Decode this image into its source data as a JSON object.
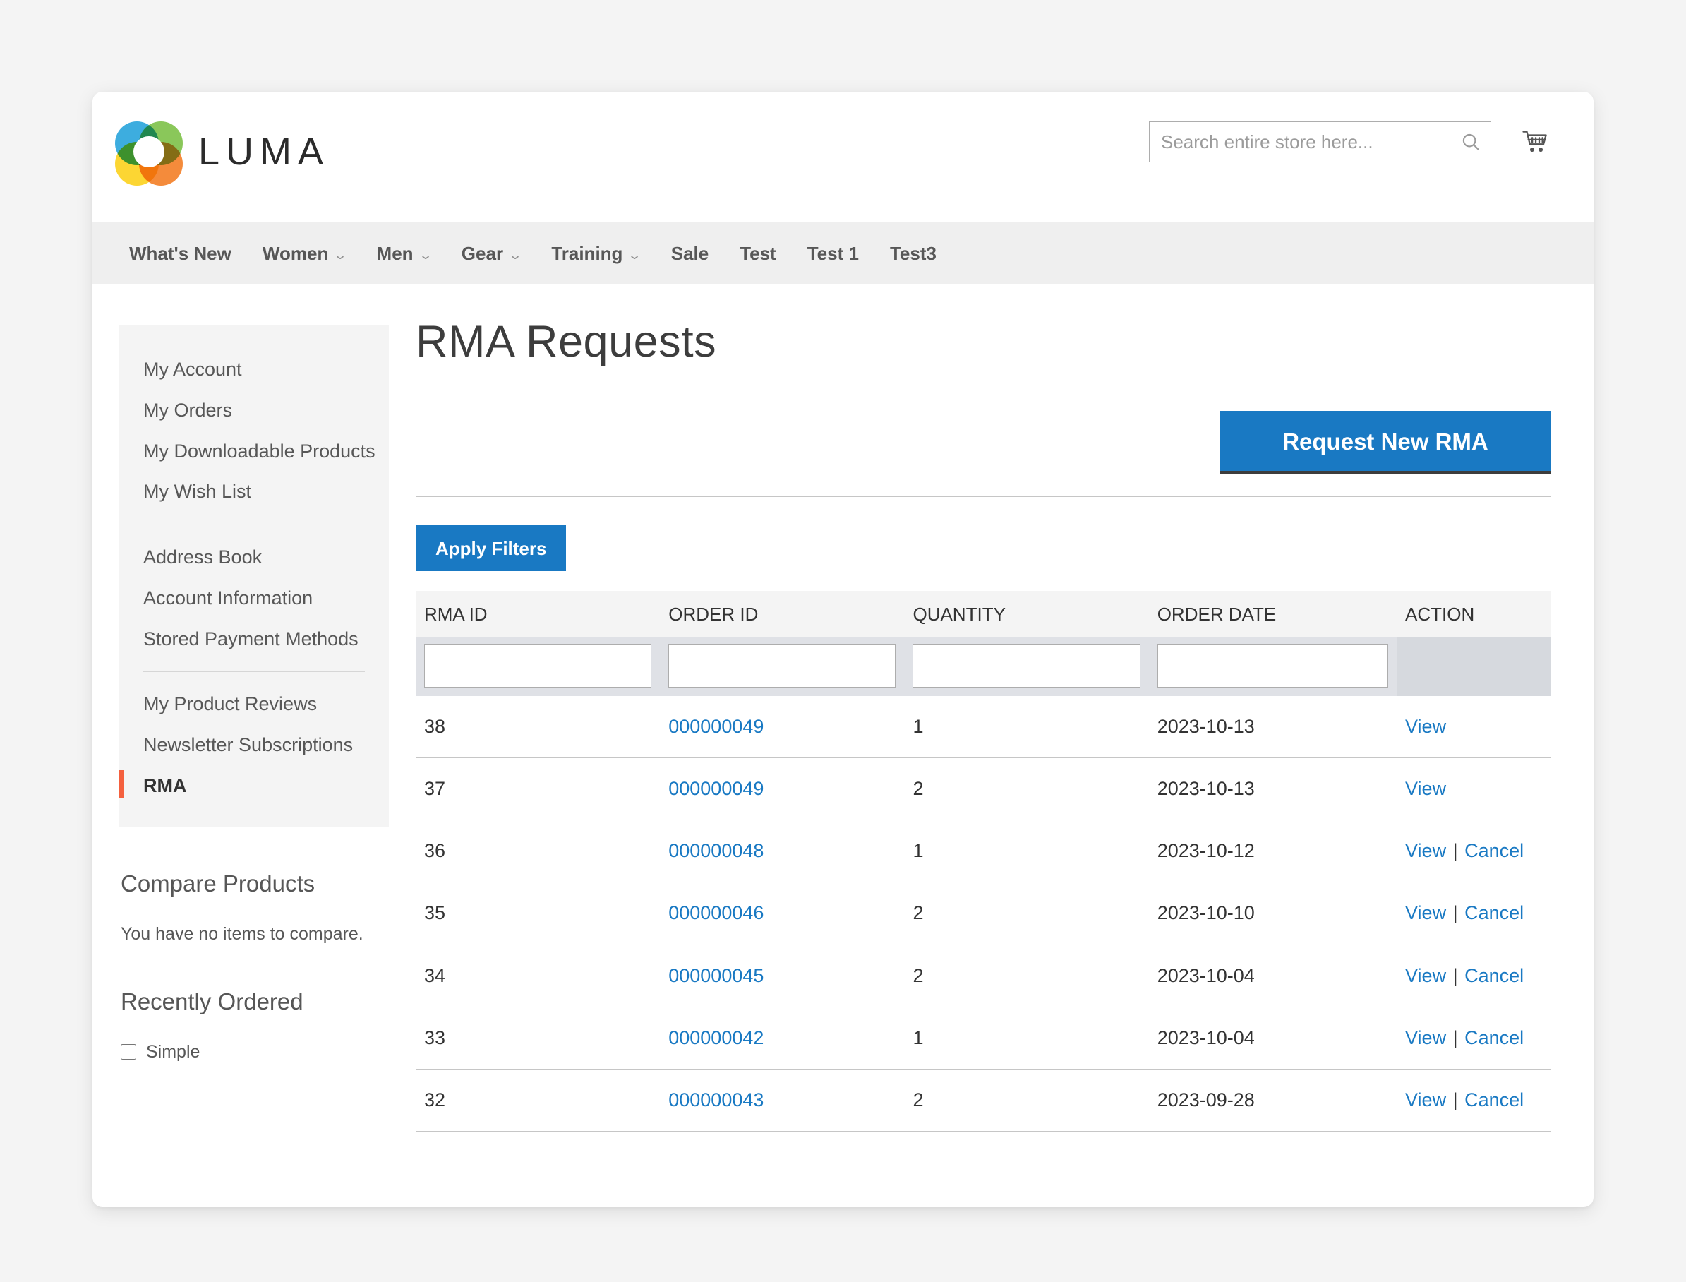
{
  "header": {
    "brand": "LUMA",
    "logo_colors": {
      "blue": "#22a2db",
      "green": "#7ac043",
      "yellow": "#fcd116",
      "orange": "#f37b20"
    },
    "search": {
      "placeholder": "Search entire store here...",
      "value": "",
      "icon": "search-icon"
    },
    "cart": {
      "icon": "shopping-cart-icon"
    }
  },
  "nav": {
    "items": [
      {
        "label": "What's New",
        "has_dropdown": false
      },
      {
        "label": "Women",
        "has_dropdown": true
      },
      {
        "label": "Men",
        "has_dropdown": true
      },
      {
        "label": "Gear",
        "has_dropdown": true
      },
      {
        "label": "Training",
        "has_dropdown": true
      },
      {
        "label": "Sale",
        "has_dropdown": false
      },
      {
        "label": "Test",
        "has_dropdown": false
      },
      {
        "label": "Test 1",
        "has_dropdown": false
      },
      {
        "label": "Test3",
        "has_dropdown": false
      }
    ],
    "chevron": "⌄"
  },
  "sidebar": {
    "groups": [
      {
        "items": [
          {
            "label": "My Account",
            "active": false
          },
          {
            "label": "My Orders",
            "active": false
          },
          {
            "label": "My Downloadable Products",
            "active": false
          },
          {
            "label": "My Wish List",
            "active": false
          }
        ]
      },
      {
        "items": [
          {
            "label": "Address Book",
            "active": false
          },
          {
            "label": "Account Information",
            "active": false
          },
          {
            "label": "Stored Payment Methods",
            "active": false
          }
        ]
      },
      {
        "items": [
          {
            "label": "My Product Reviews",
            "active": false
          },
          {
            "label": "Newsletter Subscriptions",
            "active": false
          },
          {
            "label": "RMA",
            "active": true
          }
        ]
      }
    ],
    "compare": {
      "title": "Compare Products",
      "empty_text": "You have no items to compare."
    },
    "recently_ordered": {
      "title": "Recently Ordered",
      "items": [
        {
          "label": "Simple",
          "checked": false
        }
      ]
    }
  },
  "main": {
    "page_title": "RMA Requests",
    "new_rma_label": "Request New RMA",
    "apply_filters_label": "Apply Filters",
    "accent_color": "#1979c3",
    "table": {
      "columns": [
        "RMA ID",
        "ORDER ID",
        "QUANTITY",
        "ORDER DATE",
        "ACTION"
      ],
      "filters": {
        "rma_id": "",
        "order_id": "",
        "quantity": "",
        "order_date": ""
      },
      "view_label": "View",
      "cancel_label": "Cancel",
      "separator": "|",
      "rows": [
        {
          "rma_id": "38",
          "order_id": "000000049",
          "quantity": "1",
          "order_date": "2023-10-13",
          "can_cancel": false
        },
        {
          "rma_id": "37",
          "order_id": "000000049",
          "quantity": "2",
          "order_date": "2023-10-13",
          "can_cancel": false
        },
        {
          "rma_id": "36",
          "order_id": "000000048",
          "quantity": "1",
          "order_date": "2023-10-12",
          "can_cancel": true
        },
        {
          "rma_id": "35",
          "order_id": "000000046",
          "quantity": "2",
          "order_date": "2023-10-10",
          "can_cancel": true
        },
        {
          "rma_id": "34",
          "order_id": "000000045",
          "quantity": "2",
          "order_date": "2023-10-04",
          "can_cancel": true
        },
        {
          "rma_id": "33",
          "order_id": "000000042",
          "quantity": "1",
          "order_date": "2023-10-04",
          "can_cancel": true
        },
        {
          "rma_id": "32",
          "order_id": "000000043",
          "quantity": "2",
          "order_date": "2023-09-28",
          "can_cancel": true
        }
      ]
    }
  }
}
